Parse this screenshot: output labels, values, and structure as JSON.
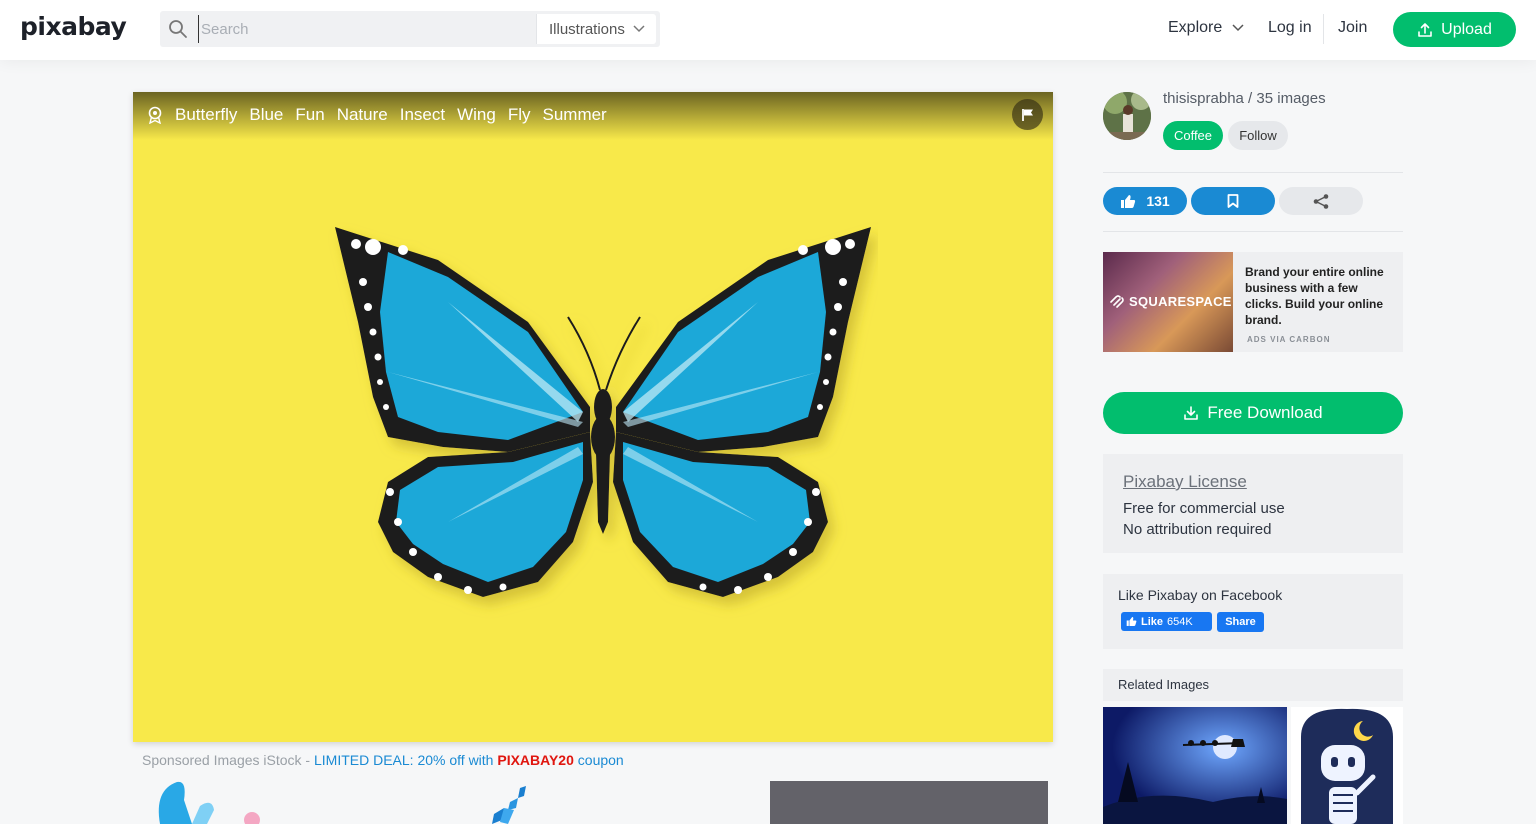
{
  "header": {
    "logo": "pixabay",
    "search_placeholder": "Search",
    "search_category": "Illustrations",
    "nav_explore": "Explore",
    "nav_login": "Log in",
    "nav_join": "Join",
    "upload_label": "Upload"
  },
  "image": {
    "tags": [
      "Butterfly",
      "Blue",
      "Fun",
      "Nature",
      "Insect",
      "Wing",
      "Fly",
      "Summer"
    ],
    "background_color": "#f8e94a",
    "butterfly_color": "#1aa8d8"
  },
  "sponsored": {
    "prefix": "Sponsored Images iStock - ",
    "deal": "LIMITED DEAL: 20% off with ",
    "code": "PIXABAY20",
    "suffix": " coupon"
  },
  "sidebar": {
    "user_line": "thisisprabha / 35 images",
    "coffee_label": "Coffee",
    "follow_label": "Follow",
    "like_count": "131",
    "ad": {
      "brand": "SQUARESPACE",
      "text": "Brand your entire online business with a few clicks. Build your online brand.",
      "via": "ADS VIA CARBON"
    },
    "download_label": "Free Download",
    "license": {
      "title": "Pixabay License",
      "line1": "Free for commercial use",
      "line2": "No attribution required"
    },
    "facebook": {
      "title": "Like Pixabay on Facebook",
      "like_label": "Like",
      "like_count": "654K",
      "share_label": "Share"
    },
    "related_title": "Related Images"
  },
  "colors": {
    "accent_green": "#02be6e",
    "accent_blue": "#1a8ad3",
    "facebook_blue": "#1877f2"
  }
}
